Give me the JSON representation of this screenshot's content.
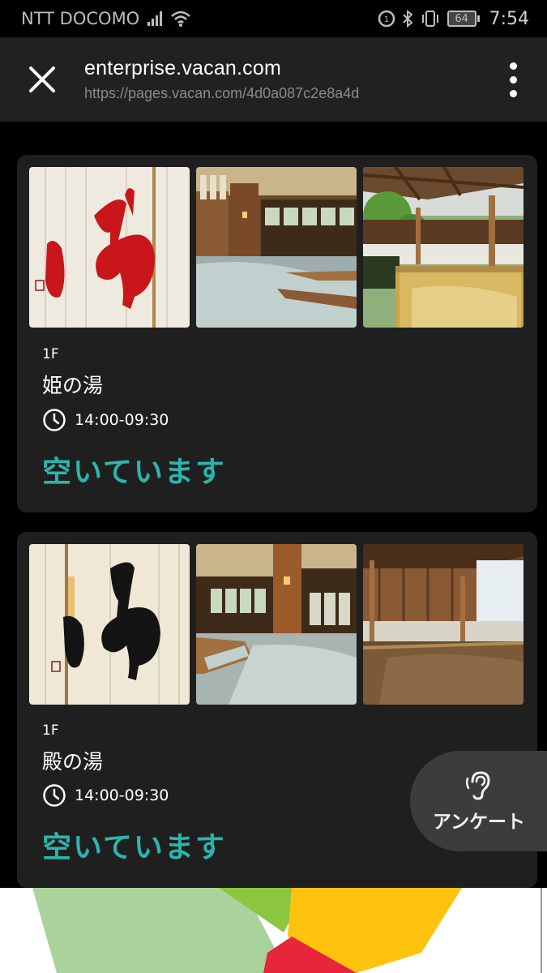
{
  "status_bar": {
    "carrier": "NTT DOCOMO",
    "time": "7:54",
    "battery": "64"
  },
  "browser": {
    "title": "enterprise.vacan.com",
    "url": "https://pages.vacan.com/4d0a087c2e8a4d"
  },
  "baths": [
    {
      "floor": "1F",
      "name": "姫の湯",
      "hours": "14:00-09:30",
      "status": "空いています",
      "status_color": "#2bb5ad",
      "noren_color": "#c8161b"
    },
    {
      "floor": "1F",
      "name": "殿の湯",
      "hours": "14:00-09:30",
      "status": "空いています",
      "status_color": "#2bb5ad",
      "noren_color": "#1a1a1a"
    }
  ],
  "survey": {
    "label": "アンケート",
    "icon": "ear-icon"
  }
}
